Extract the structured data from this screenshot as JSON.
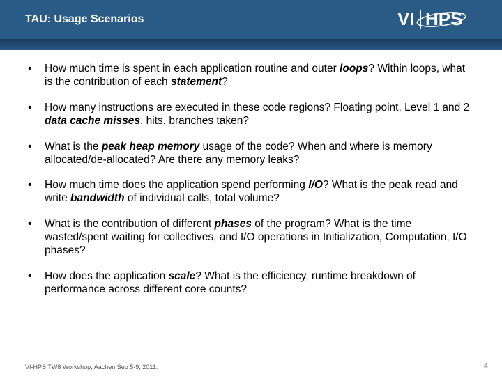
{
  "header": {
    "title": "TAU: Usage Scenarios",
    "logo_text_vi": "VI",
    "logo_text_hps": "HPS"
  },
  "bullets": [
    {
      "segments": [
        {
          "t": "How much time is spent in each application routine and outer "
        },
        {
          "t": "loops",
          "bi": true
        },
        {
          "t": "? Within loops, what is the contribution of each "
        },
        {
          "t": "statement",
          "bi": true
        },
        {
          "t": "?"
        }
      ]
    },
    {
      "segments": [
        {
          "t": "How many instructions are executed in these code regions? Floating point, Level 1 and 2 "
        },
        {
          "t": "data cache misses",
          "bi": true
        },
        {
          "t": ", hits, branches taken?"
        }
      ]
    },
    {
      "segments": [
        {
          "t": "What is the "
        },
        {
          "t": "peak heap memory",
          "bi": true
        },
        {
          "t": " usage of the code? When and where is memory allocated/de-allocated? Are there any memory leaks?"
        }
      ]
    },
    {
      "segments": [
        {
          "t": "How much time does the application spend performing "
        },
        {
          "t": "I/O",
          "bi": true
        },
        {
          "t": "?  What is the peak read and write "
        },
        {
          "t": "bandwidth",
          "bi": true
        },
        {
          "t": " of individual calls, total volume?"
        }
      ]
    },
    {
      "segments": [
        {
          "t": "What is the contribution of different "
        },
        {
          "t": "phases",
          "bi": true
        },
        {
          "t": " of the program? What is the time wasted/spent waiting for collectives, and I/O operations in Initialization, Computation, I/O phases?"
        }
      ]
    },
    {
      "segments": [
        {
          "t": "How does the application "
        },
        {
          "t": "scale",
          "bi": true
        },
        {
          "t": "? What is the efficiency, runtime breakdown of performance across different core counts?"
        }
      ]
    }
  ],
  "footer": {
    "left": "VI-HPS TW8 Workshop, Aachen Sep 5-9, 2011.",
    "page": "4"
  }
}
